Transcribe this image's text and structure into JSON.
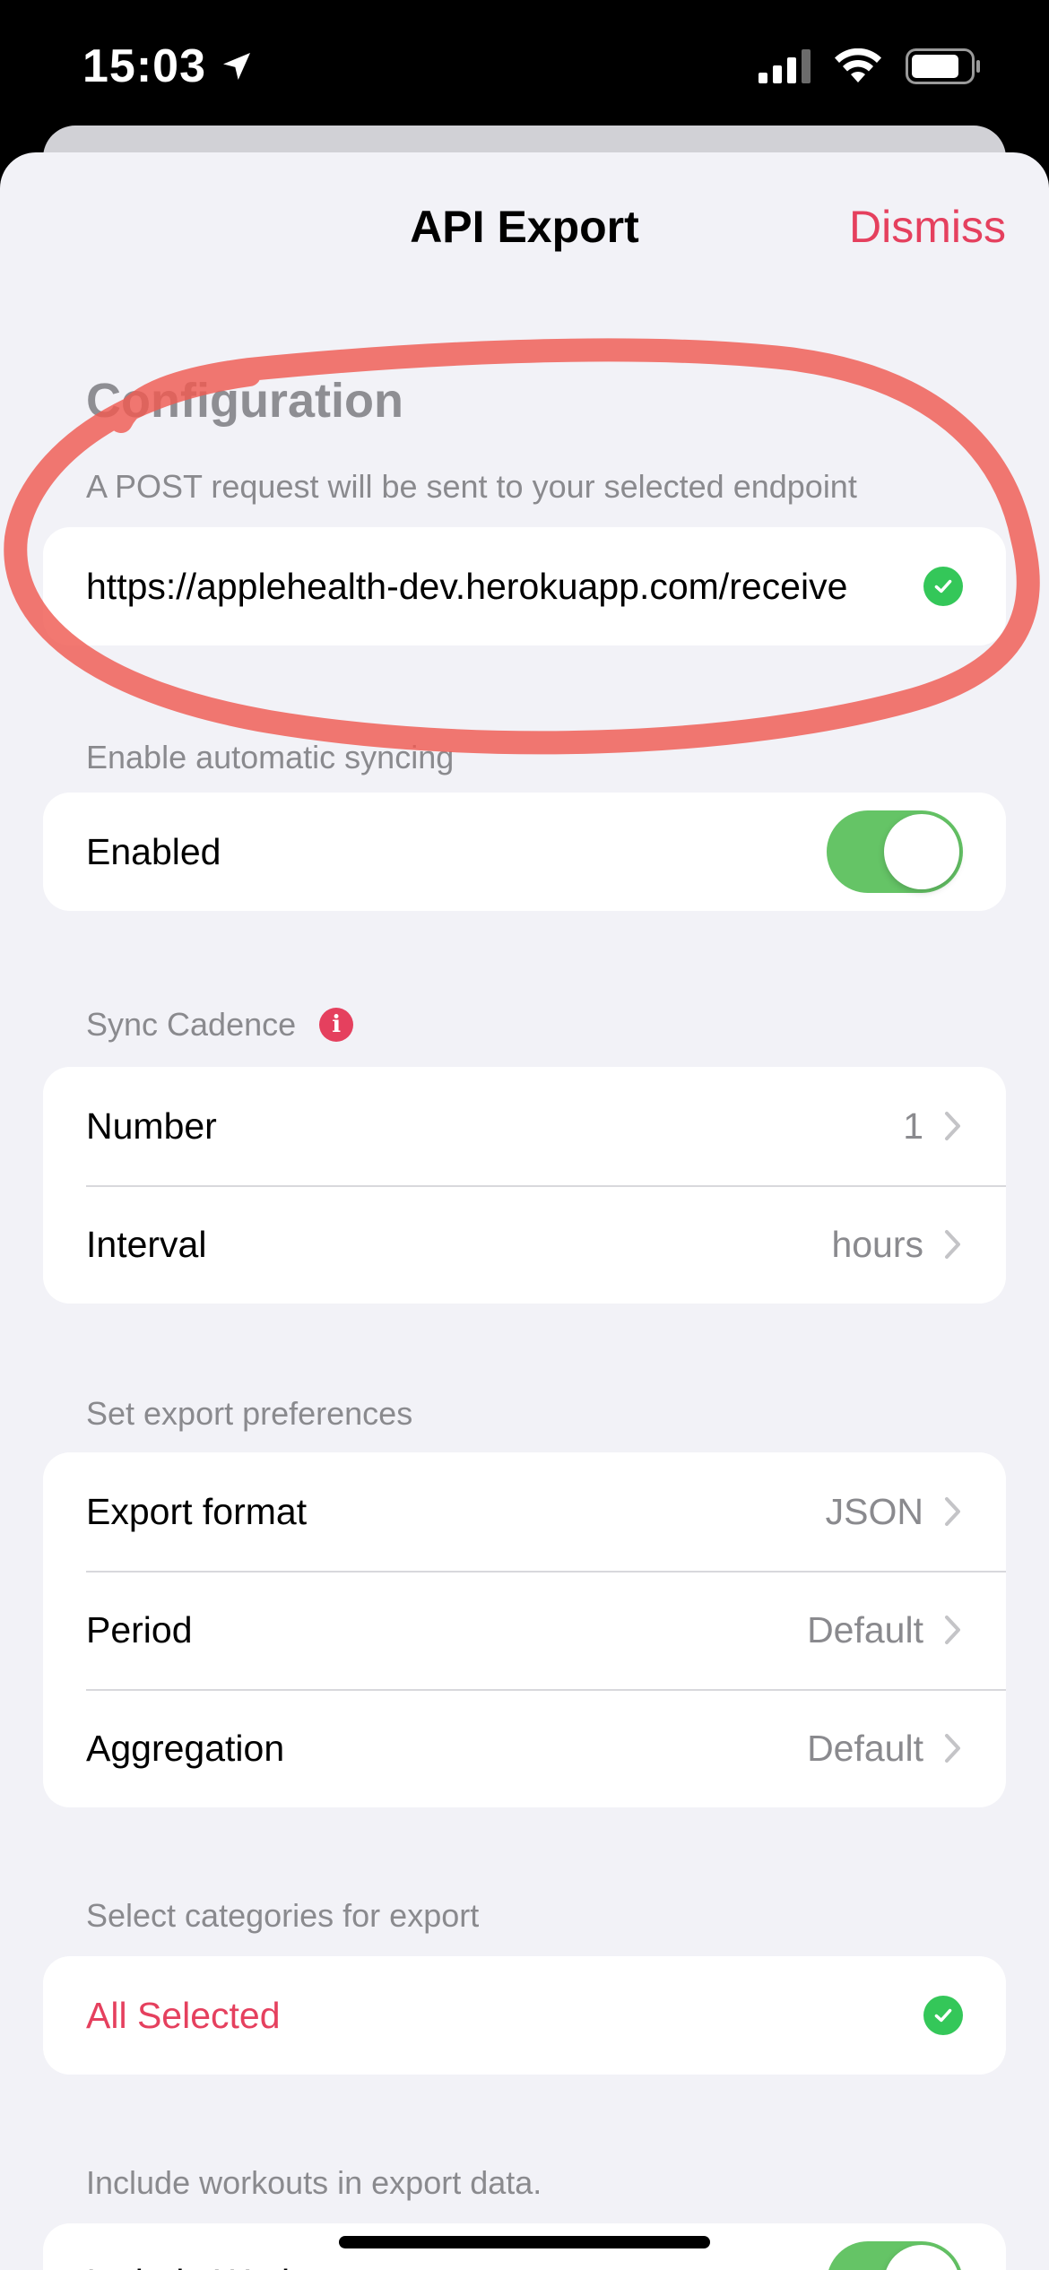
{
  "status_bar": {
    "time": "15:03"
  },
  "nav": {
    "title": "API Export",
    "dismiss_label": "Dismiss"
  },
  "configuration": {
    "title": "Configuration",
    "subtitle": "A POST request will be sent to your selected endpoint",
    "endpoint_url": "https://applehealth-dev.herokuapp.com/receive",
    "endpoint_valid": true
  },
  "auto_sync": {
    "header": "Enable automatic syncing",
    "label": "Enabled",
    "enabled": true
  },
  "sync_cadence": {
    "header": "Sync Cadence",
    "rows": [
      {
        "label": "Number",
        "value": "1"
      },
      {
        "label": "Interval",
        "value": "hours"
      }
    ]
  },
  "export_preferences": {
    "header": "Set export preferences",
    "rows": [
      {
        "label": "Export format",
        "value": "JSON"
      },
      {
        "label": "Period",
        "value": "Default"
      },
      {
        "label": "Aggregation",
        "value": "Default"
      }
    ]
  },
  "categories": {
    "header": "Select categories for export",
    "label": "All Selected",
    "selected": true
  },
  "workouts": {
    "header": "Include workouts in export data.",
    "label": "Include Workouts",
    "enabled": true
  },
  "colors": {
    "accent": "#e5405e",
    "toggle_on": "#65c466",
    "check": "#34c759",
    "background": "#f2f2f7",
    "annotation": "#ef5a52"
  },
  "icons": {
    "status_bar": [
      "location-arrow-icon",
      "cellular-signal-icon",
      "wifi-icon",
      "battery-icon"
    ],
    "rows": [
      "chevron-right-icon",
      "checkmark-icon",
      "info-icon"
    ]
  }
}
